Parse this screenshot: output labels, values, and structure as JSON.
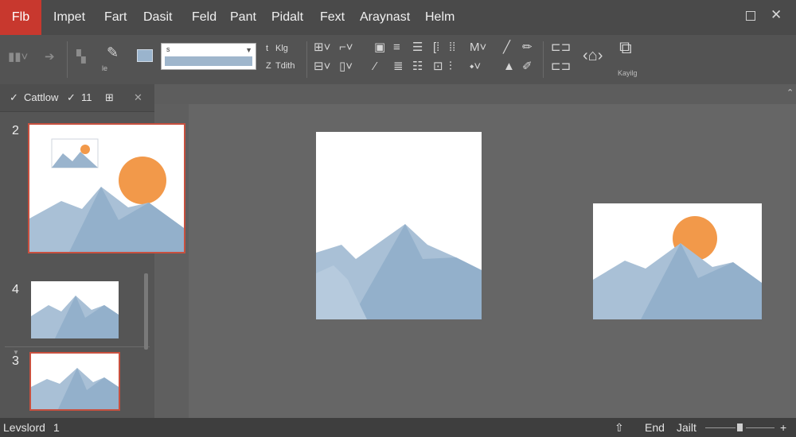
{
  "menubar": {
    "file_tab": "Flb",
    "items": [
      "Impet",
      "Fart",
      "Dasit",
      "Feld",
      "Pant",
      "Pidalt",
      "Fext",
      "Araynast",
      "Helm"
    ]
  },
  "ribbon": {
    "font_value": "s",
    "size_label_1": "Klg",
    "size_label_2": "Tdith",
    "prefix_1": "t",
    "prefix_2": "Z",
    "icon_caption": "Kayilg",
    "small_caption": "le"
  },
  "panel": {
    "header_label": "Cattlow",
    "header_count": "11"
  },
  "slides": {
    "thumb_numbers": [
      "2",
      "4",
      "3"
    ]
  },
  "status": {
    "left_label": "Levslord",
    "left_count": "1",
    "end_label": "End",
    "jalt_label": "Jailt"
  },
  "colors": {
    "accent": "#c8382e",
    "selection": "#c8503f",
    "mountain_light": "#a9c0d6",
    "mountain_dark": "#93b0cb",
    "sun": "#f2994a"
  }
}
